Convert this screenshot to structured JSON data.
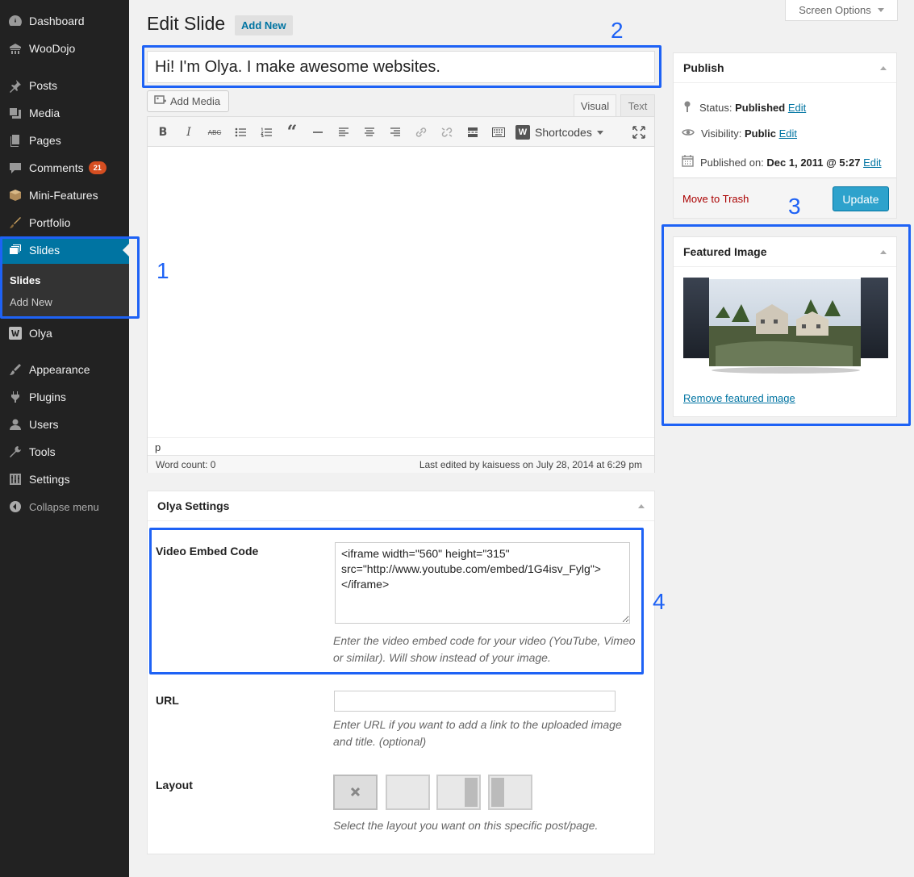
{
  "sidebar": {
    "items": [
      {
        "label": "Dashboard",
        "icon": "dashboard-icon"
      },
      {
        "label": "WooDojo",
        "icon": "woodojo-icon"
      },
      {
        "label": "Posts",
        "icon": "pin-icon"
      },
      {
        "label": "Media",
        "icon": "media-icon"
      },
      {
        "label": "Pages",
        "icon": "pages-icon"
      },
      {
        "label": "Comments",
        "icon": "comment-icon",
        "badge": "21"
      },
      {
        "label": "Mini-Features",
        "icon": "box-icon"
      },
      {
        "label": "Portfolio",
        "icon": "brush-icon"
      },
      {
        "label": "Slides",
        "icon": "slides-icon"
      },
      {
        "label": "Olya",
        "icon": "olya-icon"
      },
      {
        "label": "Appearance",
        "icon": "appearance-icon"
      },
      {
        "label": "Plugins",
        "icon": "plugin-icon"
      },
      {
        "label": "Users",
        "icon": "users-icon"
      },
      {
        "label": "Tools",
        "icon": "wrench-icon"
      },
      {
        "label": "Settings",
        "icon": "settings-icon"
      }
    ],
    "submenu": [
      "Slides",
      "Add New"
    ],
    "collapse": "Collapse menu"
  },
  "header": {
    "title": "Edit Slide",
    "add_new": "Add New",
    "screen_options": "Screen Options"
  },
  "post": {
    "title": "Hi! I'm Olya. I make awesome websites."
  },
  "editor": {
    "add_media": "Add Media",
    "tab_visual": "Visual",
    "tab_text": "Text",
    "shortcodes": "Shortcodes",
    "path": "p",
    "word_count": "Word count: 0",
    "last_edited": "Last edited by kaisuess on July 28, 2014 at 6:29 pm"
  },
  "olya_settings": {
    "title": "Olya Settings",
    "video_label": "Video Embed Code",
    "video_value": "<iframe width=\"560\" height=\"315\" src=\"http://www.youtube.com/embed/1G4isv_Fylg\"></iframe>",
    "video_desc": "Enter the video embed code for your video (YouTube, Vimeo or similar). Will show instead of your image.",
    "url_label": "URL",
    "url_value": "",
    "url_desc": "Enter URL if you want to add a link to the uploaded image and title. (optional)",
    "layout_label": "Layout",
    "layout_desc": "Select the layout you want on this specific post/page."
  },
  "publish": {
    "title": "Publish",
    "status_label": "Status:",
    "status_value": "Published",
    "visibility_label": "Visibility:",
    "visibility_value": "Public",
    "published_label": "Published on:",
    "published_value": "Dec 1, 2011 @ 5:27",
    "edit": "Edit",
    "move_to_trash": "Move to Trash",
    "update": "Update"
  },
  "featured_image": {
    "title": "Featured Image",
    "remove": "Remove featured image"
  },
  "annotations": [
    "1",
    "2",
    "3",
    "4"
  ],
  "colors": {
    "sidebar_bg": "#222222",
    "current_menu": "#0074a2",
    "annotation": "#1e62f5",
    "update_button": "#2ea2cc"
  }
}
